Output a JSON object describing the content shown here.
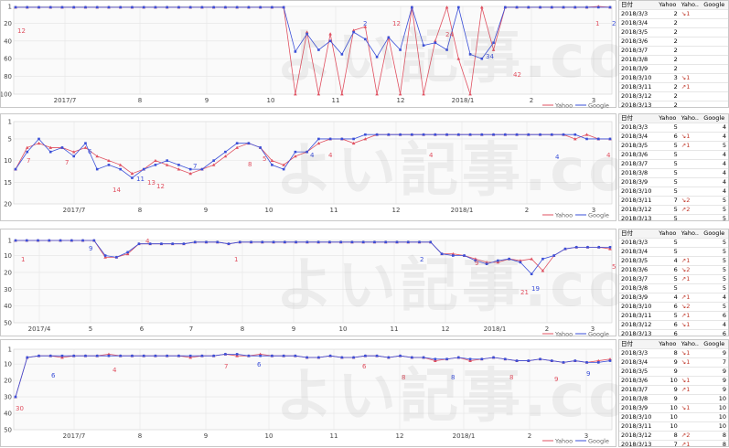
{
  "colors": {
    "yahoo": "#e05060",
    "google": "#3a4fd8",
    "grid": "#e4e4e4",
    "accent": "#c0392b"
  },
  "legend": {
    "yahoo": "Yahoo",
    "google": "Google"
  },
  "watermark": "よい記事.com",
  "table_headers": {
    "date": "日付",
    "yahoo": "Yahoo",
    "change": "Yaho..",
    "google": "Google"
  },
  "panels": [
    {
      "id": "p1",
      "yticks": [
        "1",
        "20",
        "40",
        "60",
        "80",
        "100"
      ],
      "xticks": [
        "2017/7",
        "8",
        "9",
        "10",
        "11",
        "12",
        "2018/1",
        "2",
        "3"
      ],
      "ann": [
        "12",
        "2",
        "12",
        "24",
        "34",
        "42",
        "1",
        "2"
      ],
      "table": [
        [
          "2018/3/3",
          "2",
          "↘1",
          ""
        ],
        [
          "2018/3/4",
          "2",
          "",
          ""
        ],
        [
          "2018/3/5",
          "2",
          "",
          ""
        ],
        [
          "2018/3/6",
          "2",
          "",
          ""
        ],
        [
          "2018/3/7",
          "2",
          "",
          ""
        ],
        [
          "2018/3/8",
          "2",
          "",
          ""
        ],
        [
          "2018/3/9",
          "2",
          "",
          ""
        ],
        [
          "2018/3/10",
          "3",
          "↘1",
          ""
        ],
        [
          "2018/3/11",
          "2",
          "↗1",
          ""
        ],
        [
          "2018/3/12",
          "2",
          "",
          ""
        ],
        [
          "2018/3/13",
          "2",
          "",
          ""
        ]
      ]
    },
    {
      "id": "p2",
      "yticks": [
        "1",
        "5",
        "10",
        "15",
        "20"
      ],
      "xticks": [
        "2017/7",
        "8",
        "9",
        "10",
        "11",
        "12",
        "2018/1",
        "2",
        "3"
      ],
      "ann": [
        "7",
        "6",
        "7",
        "14",
        "11",
        "13",
        "12",
        "7",
        "8",
        "5",
        "4",
        "4",
        "4",
        "4",
        "4"
      ],
      "table": [
        [
          "2018/3/3",
          "5",
          "",
          "4"
        ],
        [
          "2018/3/4",
          "6",
          "↘1",
          "4"
        ],
        [
          "2018/3/5",
          "5",
          "↗1",
          "5"
        ],
        [
          "2018/3/6",
          "5",
          "",
          "4"
        ],
        [
          "2018/3/7",
          "5",
          "",
          "4"
        ],
        [
          "2018/3/8",
          "5",
          "",
          "4"
        ],
        [
          "2018/3/9",
          "5",
          "",
          "4"
        ],
        [
          "2018/3/10",
          "5",
          "",
          "4"
        ],
        [
          "2018/3/11",
          "7",
          "↘2",
          "5"
        ],
        [
          "2018/3/12",
          "5",
          "↗2",
          "5"
        ],
        [
          "2018/3/13",
          "5",
          "",
          "5"
        ]
      ]
    },
    {
      "id": "p3",
      "yticks": [
        "1",
        "10",
        "20",
        "30",
        "40",
        "50"
      ],
      "xticks": [
        "2017/4",
        "5",
        "6",
        "7",
        "8",
        "9",
        "10",
        "11",
        "12",
        "2018/1",
        "2",
        "3"
      ],
      "ann": [
        "1",
        "9",
        "4",
        "1",
        "2",
        "9",
        "21",
        "19",
        "5"
      ],
      "table": [
        [
          "2018/3/3",
          "5",
          "",
          "5"
        ],
        [
          "2018/3/4",
          "5",
          "",
          "5"
        ],
        [
          "2018/3/5",
          "4",
          "↗1",
          "5"
        ],
        [
          "2018/3/6",
          "6",
          "↘2",
          "5"
        ],
        [
          "2018/3/7",
          "5",
          "↗1",
          "5"
        ],
        [
          "2018/3/8",
          "5",
          "",
          "5"
        ],
        [
          "2018/3/9",
          "4",
          "↗1",
          "4"
        ],
        [
          "2018/3/10",
          "6",
          "↘2",
          "5"
        ],
        [
          "2018/3/11",
          "5",
          "↗1",
          "6"
        ],
        [
          "2018/3/12",
          "6",
          "↘1",
          "4"
        ],
        [
          "2018/3/13",
          "6",
          "",
          "6"
        ]
      ]
    },
    {
      "id": "p4",
      "yticks": [
        "1",
        "10",
        "20",
        "30",
        "40",
        "50"
      ],
      "xticks": [
        "2017/7",
        "8",
        "9",
        "10",
        "11",
        "12",
        "2018/1",
        "2",
        "3"
      ],
      "ann": [
        "30",
        "6",
        "4",
        "7",
        "6",
        "6",
        "8",
        "8",
        "8",
        "9",
        "9"
      ],
      "table": [
        [
          "2018/3/3",
          "8",
          "↘1",
          "9"
        ],
        [
          "2018/3/4",
          "9",
          "↘1",
          "7"
        ],
        [
          "2018/3/5",
          "9",
          "",
          "9"
        ],
        [
          "2018/3/6",
          "10",
          "↘1",
          "9"
        ],
        [
          "2018/3/7",
          "9",
          "↗1",
          "9"
        ],
        [
          "2018/3/8",
          "9",
          "",
          "10"
        ],
        [
          "2018/3/9",
          "10",
          "↘1",
          "10"
        ],
        [
          "2018/3/10",
          "10",
          "",
          "10"
        ],
        [
          "2018/3/11",
          "10",
          "",
          "10"
        ],
        [
          "2018/3/12",
          "8",
          "↗2",
          "8"
        ],
        [
          "2018/3/13",
          "7",
          "↗1",
          "8"
        ]
      ]
    }
  ],
  "chart_data": [
    {
      "type": "line",
      "title": "",
      "ylim": [
        100,
        1
      ],
      "x": [
        "2017/7",
        "8",
        "9",
        "10",
        "11",
        "12",
        "2018/1",
        "2",
        "3"
      ],
      "series": [
        {
          "name": "Yahoo",
          "values": [
            2,
            2,
            2,
            2,
            2,
            2,
            2,
            2,
            2,
            2,
            2,
            2,
            2,
            2,
            2,
            2,
            2,
            2,
            2,
            2,
            2,
            2,
            2,
            2,
            100,
            30,
            100,
            32,
            100,
            28,
            24,
            100,
            36,
            100,
            2,
            100,
            40,
            2,
            60,
            100,
            2,
            50,
            2,
            2,
            2,
            2,
            2,
            2,
            2,
            2,
            1,
            2
          ]
        },
        {
          "name": "Google",
          "values": [
            2,
            2,
            2,
            2,
            2,
            2,
            2,
            2,
            2,
            2,
            2,
            2,
            2,
            2,
            2,
            2,
            2,
            2,
            2,
            2,
            2,
            2,
            2,
            2,
            52,
            32,
            50,
            40,
            55,
            30,
            38,
            58,
            36,
            50,
            2,
            45,
            42,
            50,
            2,
            55,
            60,
            42,
            2,
            2,
            2,
            2,
            2,
            2,
            2,
            2,
            2,
            2
          ]
        }
      ]
    },
    {
      "type": "line",
      "title": "",
      "ylim": [
        20,
        1
      ],
      "x": [
        "2017/7",
        "8",
        "9",
        "10",
        "11",
        "12",
        "2018/1",
        "2",
        "3"
      ],
      "series": [
        {
          "name": "Yahoo",
          "values": [
            12,
            7,
            6,
            7,
            7,
            8,
            7,
            9,
            10,
            11,
            13,
            12,
            10,
            11,
            12,
            13,
            12,
            11,
            9,
            7,
            6,
            7,
            10,
            11,
            9,
            8,
            6,
            5,
            5,
            6,
            5,
            4,
            4,
            4,
            4,
            4,
            4,
            4,
            4,
            4,
            4,
            4,
            4,
            4,
            4,
            4,
            4,
            4,
            5,
            4,
            5,
            5
          ]
        },
        {
          "name": "Google",
          "values": [
            12,
            8,
            5,
            8,
            7,
            9,
            6,
            12,
            11,
            12,
            14,
            12,
            11,
            10,
            11,
            12,
            12,
            10,
            8,
            6,
            6,
            7,
            11,
            12,
            8,
            8,
            5,
            5,
            5,
            5,
            4,
            4,
            4,
            4,
            4,
            4,
            4,
            4,
            4,
            4,
            4,
            4,
            4,
            4,
            4,
            4,
            4,
            4,
            4,
            5,
            5,
            5
          ]
        }
      ]
    },
    {
      "type": "line",
      "title": "",
      "ylim": [
        50,
        1
      ],
      "x": [
        "2017/4",
        "5",
        "6",
        "7",
        "8",
        "9",
        "10",
        "11",
        "12",
        "2018/1",
        "2",
        "3"
      ],
      "series": [
        {
          "name": "Yahoo",
          "values": [
            1,
            1,
            1,
            1,
            1,
            1,
            1,
            1,
            11,
            11,
            9,
            3,
            3,
            3,
            3,
            3,
            2,
            2,
            2,
            3,
            2,
            2,
            2,
            2,
            2,
            2,
            2,
            2,
            2,
            2,
            2,
            2,
            2,
            2,
            2,
            2,
            2,
            2,
            9,
            9,
            10,
            12,
            14,
            14,
            12,
            13,
            12,
            19,
            10,
            6,
            5,
            5,
            5,
            6
          ]
        },
        {
          "name": "Google",
          "values": [
            1,
            1,
            1,
            1,
            1,
            1,
            1,
            1,
            10,
            11,
            8,
            3,
            3,
            3,
            3,
            3,
            2,
            2,
            2,
            3,
            2,
            2,
            2,
            2,
            2,
            2,
            2,
            2,
            2,
            2,
            2,
            2,
            2,
            2,
            2,
            2,
            2,
            2,
            9,
            10,
            10,
            13,
            15,
            13,
            12,
            14,
            21,
            12,
            10,
            6,
            5,
            5,
            5,
            5
          ]
        }
      ]
    },
    {
      "type": "line",
      "title": "",
      "ylim": [
        50,
        1
      ],
      "x": [
        "2017/7",
        "8",
        "9",
        "10",
        "11",
        "12",
        "2018/1",
        "2",
        "3"
      ],
      "series": [
        {
          "name": "Yahoo",
          "values": [
            30,
            6,
            5,
            5,
            6,
            5,
            5,
            5,
            4,
            5,
            5,
            5,
            5,
            5,
            5,
            6,
            5,
            5,
            4,
            5,
            5,
            4,
            5,
            5,
            5,
            6,
            6,
            5,
            6,
            6,
            5,
            5,
            6,
            5,
            6,
            6,
            8,
            7,
            6,
            8,
            7,
            6,
            7,
            8,
            8,
            7,
            8,
            9,
            8,
            9,
            8,
            7
          ]
        },
        {
          "name": "Google",
          "values": [
            30,
            6,
            5,
            5,
            5,
            5,
            5,
            5,
            5,
            5,
            5,
            5,
            5,
            5,
            5,
            5,
            5,
            5,
            4,
            4,
            5,
            5,
            5,
            5,
            5,
            6,
            6,
            5,
            6,
            6,
            5,
            5,
            6,
            5,
            6,
            6,
            7,
            7,
            6,
            7,
            7,
            6,
            7,
            8,
            8,
            7,
            8,
            9,
            8,
            9,
            9,
            8
          ]
        }
      ]
    }
  ]
}
